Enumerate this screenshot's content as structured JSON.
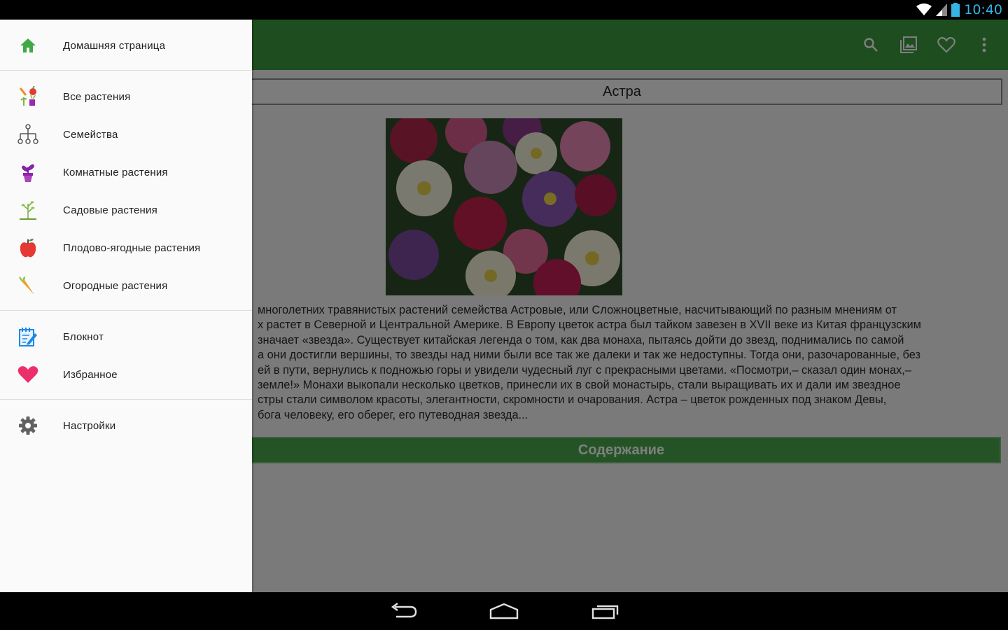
{
  "status_bar": {
    "time": "10:40",
    "icons": [
      "wifi-icon",
      "cell-signal-icon",
      "battery-icon"
    ],
    "clock_color": "#33b5e5"
  },
  "toolbar": {
    "color": "#3c9b3f",
    "actions": [
      "search-icon",
      "gallery-icon",
      "heart-icon",
      "overflow-menu-icon"
    ]
  },
  "article": {
    "title": "Астра",
    "description_lines": [
      "многолетних травянистых растений семейства Астровые, или Сложноцветные, насчитывающий по разным мнениям от",
      "х растет в Северной и Центральной Америке. В Европу цветок астра был тайком завезен в XVII веке из Китая французским",
      "значает «звезда». Существует китайская легенда о том, как два монаха, пытаясь дойти до звезд, поднимались по самой",
      "а они достигли вершины, то звезды над ними были все так же далеки и так же недоступны. Тогда они, разочарованные, без",
      "ей в пути, вернулись к подножью горы и увидели чудесный луг с прекрасными цветами. «Посмотри,– сказал один монах,–",
      "земле!» Монахи выкопали несколько цветков, принесли их в свой монастырь, стали выращивать их и дали им звездное",
      "стры стали символом красоты, элегантности, скромности и очарования. Астра – цветок рожденных под знаком Девы,",
      "бога человеку, его оберег, его путеводная звезда..."
    ],
    "contents_button": "Содержание"
  },
  "drawer": {
    "home": {
      "label": "Домашняя страница",
      "icon": "home-icon"
    },
    "catalog": [
      {
        "label": "Все растения",
        "icon": "all-plants-icon"
      },
      {
        "label": "Семейства",
        "icon": "family-tree-icon"
      },
      {
        "label": "Комнатные растения",
        "icon": "potted-plant-icon"
      },
      {
        "label": "Садовые растения",
        "icon": "garden-sprout-icon"
      },
      {
        "label": "Плодово-ягодные растения",
        "icon": "apple-icon"
      },
      {
        "label": "Огородные растения",
        "icon": "carrot-icon"
      }
    ],
    "tools": [
      {
        "label": "Блокнот",
        "icon": "notepad-icon"
      },
      {
        "label": "Избранное",
        "icon": "favorite-heart-icon"
      }
    ],
    "settings": {
      "label": "Настройки",
      "icon": "gear-icon"
    }
  },
  "nav_bar": {
    "buttons": [
      "back-icon",
      "home-nav-icon",
      "recents-icon"
    ]
  }
}
